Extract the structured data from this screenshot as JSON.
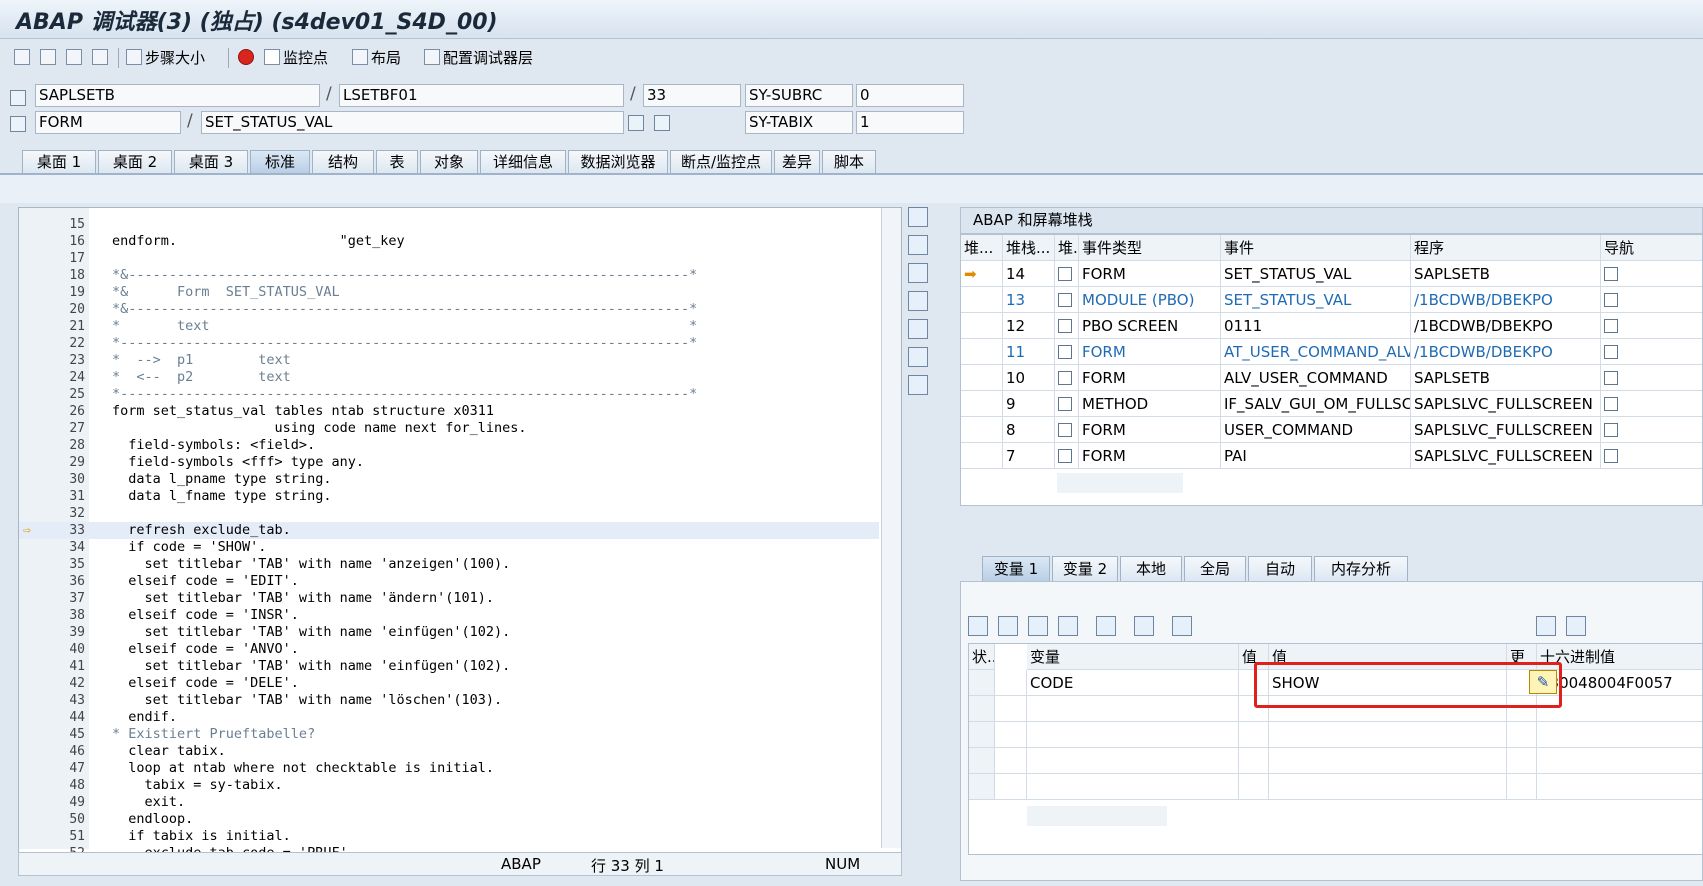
{
  "window": {
    "title": "ABAP 调试器(3) (独占) (s4dev01_S4D_00)"
  },
  "toolbar": {
    "step_size_label": "步骤大小",
    "watchpoint_label": "监控点",
    "layout_label": "布局",
    "config_label": "配置调试器层"
  },
  "header": {
    "program": "SAPLSETB",
    "include": "LSETBF01",
    "line": "33",
    "sy_subrc_label": "SY-SUBRC",
    "sy_subrc_value": "0",
    "event_type": "FORM",
    "event": "SET_STATUS_VAL",
    "sy_tabix_label": "SY-TABIX",
    "sy_tabix_value": "1"
  },
  "tabs": [
    "桌面 1",
    "桌面 2",
    "桌面 3",
    "标准",
    "结构",
    "表",
    "对象",
    "详细信息",
    "数据浏览器",
    "断点/监控点",
    "差异",
    "脚本"
  ],
  "code": [
    {
      "n": "15",
      "t": ""
    },
    {
      "n": "16",
      "t": "endform.                    \"get_key"
    },
    {
      "n": "17",
      "t": ""
    },
    {
      "n": "18",
      "t": "*&---------------------------------------------------------------------*"
    },
    {
      "n": "19",
      "t": "*&      Form  SET_STATUS_VAL"
    },
    {
      "n": "20",
      "t": "*&---------------------------------------------------------------------*"
    },
    {
      "n": "21",
      "t": "*       text                                                           *"
    },
    {
      "n": "22",
      "t": "*----------------------------------------------------------------------*"
    },
    {
      "n": "23",
      "t": "*  -->  p1        text"
    },
    {
      "n": "24",
      "t": "*  <--  p2        text"
    },
    {
      "n": "25",
      "t": "*----------------------------------------------------------------------*"
    },
    {
      "n": "26",
      "t": "form set_status_val tables ntab structure x0311"
    },
    {
      "n": "27",
      "t": "                    using code name next for_lines."
    },
    {
      "n": "28",
      "t": "  field-symbols: <field>."
    },
    {
      "n": "29",
      "t": "  field-symbols <fff> type any."
    },
    {
      "n": "30",
      "t": "  data l_pname type string."
    },
    {
      "n": "31",
      "t": "  data l_fname type string."
    },
    {
      "n": "32",
      "t": ""
    },
    {
      "n": "33",
      "t": "  refresh exclude_tab."
    },
    {
      "n": "34",
      "t": "  if code = 'SHOW'."
    },
    {
      "n": "35",
      "t": "    set titlebar 'TAB' with name 'anzeigen'(100)."
    },
    {
      "n": "36",
      "t": "  elseif code = 'EDIT'."
    },
    {
      "n": "37",
      "t": "    set titlebar 'TAB' with name 'ändern'(101)."
    },
    {
      "n": "38",
      "t": "  elseif code = 'INSR'."
    },
    {
      "n": "39",
      "t": "    set titlebar 'TAB' with name 'einfügen'(102)."
    },
    {
      "n": "40",
      "t": "  elseif code = 'ANVO'."
    },
    {
      "n": "41",
      "t": "    set titlebar 'TAB' with name 'einfügen'(102)."
    },
    {
      "n": "42",
      "t": "  elseif code = 'DELE'."
    },
    {
      "n": "43",
      "t": "    set titlebar 'TAB' with name 'löschen'(103)."
    },
    {
      "n": "44",
      "t": "  endif."
    },
    {
      "n": "45",
      "t": "* Existiert Prueftabelle?"
    },
    {
      "n": "46",
      "t": "  clear tabix."
    },
    {
      "n": "47",
      "t": "  loop at ntab where not checktable is initial."
    },
    {
      "n": "48",
      "t": "    tabix = sy-tabix."
    },
    {
      "n": "49",
      "t": "    exit."
    },
    {
      "n": "50",
      "t": "  endloop."
    },
    {
      "n": "51",
      "t": "  if tabix is initial."
    },
    {
      "n": "52",
      "t": "    exclude_tab-code = 'PRUF'."
    }
  ],
  "status": {
    "lang": "ABAP",
    "position": "行  33 列    1",
    "num": "NUM"
  },
  "stack": {
    "title": "ABAP 和屏幕堆栈",
    "columns": [
      "堆...",
      "堆栈...",
      "堆.",
      "事件类型",
      "事件",
      "程序",
      "导航"
    ],
    "rows": [
      {
        "depth": "14",
        "type": "FORM",
        "event": "SET_STATUS_VAL",
        "program": "SAPLSETB",
        "current": true,
        "blue": false
      },
      {
        "depth": "13",
        "type": "MODULE (PBO)",
        "event": "SET_STATUS_VAL",
        "program": "/1BCDWB/DBEKPO",
        "current": false,
        "blue": true
      },
      {
        "depth": "12",
        "type": "PBO SCREEN",
        "event": "0111",
        "program": "/1BCDWB/DBEKPO",
        "current": false,
        "blue": false
      },
      {
        "depth": "11",
        "type": "FORM",
        "event": "AT_USER_COMMAND_ALV",
        "program": "/1BCDWB/DBEKPO",
        "current": false,
        "blue": true
      },
      {
        "depth": "10",
        "type": "FORM",
        "event": "ALV_USER_COMMAND",
        "program": "SAPLSETB",
        "current": false,
        "blue": false
      },
      {
        "depth": "9",
        "type": "METHOD",
        "event": "IF_SALV_GUI_OM_FULLSC...",
        "program": "SAPLSLVC_FULLSCREEN",
        "current": false,
        "blue": false
      },
      {
        "depth": "8",
        "type": "FORM",
        "event": "USER_COMMAND",
        "program": "SAPLSLVC_FULLSCREEN",
        "current": false,
        "blue": false
      },
      {
        "depth": "7",
        "type": "FORM",
        "event": "PAI",
        "program": "SAPLSLVC_FULLSCREEN",
        "current": false,
        "blue": false
      }
    ]
  },
  "var_tabs": [
    "变量 1",
    "变量 2",
    "本地",
    "全局",
    "自动",
    "内存分析"
  ],
  "vars": {
    "columns": [
      "状...",
      "变量",
      "值",
      "值",
      "更",
      "十六进制值"
    ],
    "rows": [
      {
        "name": "CODE",
        "value": "SHOW",
        "hex": "530048004F0057"
      }
    ]
  }
}
